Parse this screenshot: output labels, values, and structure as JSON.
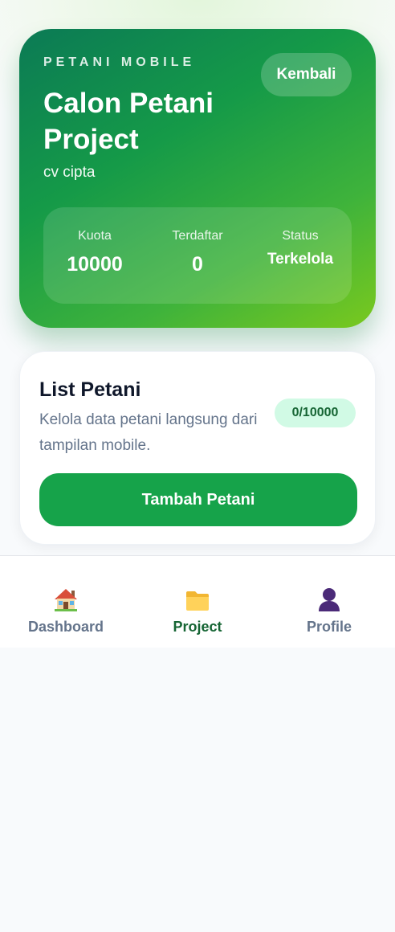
{
  "hero": {
    "kicker": "PETANI MOBILE",
    "title": "Calon Petani Project",
    "subtitle": "cv cipta",
    "back_label": "Kembali",
    "stats": [
      {
        "label": "Kuota",
        "value": "10000"
      },
      {
        "label": "Terdaftar",
        "value": "0"
      },
      {
        "label": "Status",
        "value": "Terkelola"
      }
    ]
  },
  "list_card": {
    "title": "List Petani",
    "description": "Kelola data petani langsung dari tampilan mobile.",
    "badge": "0/10000",
    "add_button": "Tambah Petani"
  },
  "bottom_nav": {
    "items": [
      {
        "label": "Dashboard",
        "icon": "house-icon",
        "active": false
      },
      {
        "label": "Project",
        "icon": "folder-icon",
        "active": true
      },
      {
        "label": "Profile",
        "icon": "person-icon",
        "active": false
      }
    ]
  },
  "colors": {
    "primary": "#16a34a",
    "primary_dark": "#166534",
    "badge_bg": "#d1fae5",
    "muted_text": "#64748b",
    "dark_text": "#0f172a"
  }
}
